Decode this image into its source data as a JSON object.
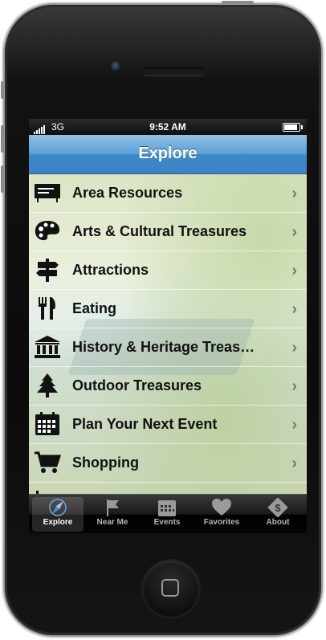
{
  "status_bar": {
    "network": "3G",
    "time": "9:52 AM"
  },
  "nav": {
    "title": "Explore"
  },
  "menu": [
    {
      "label": "Area Resources",
      "icon": "sign-board-icon"
    },
    {
      "label": "Arts & Cultural Treasures",
      "icon": "palette-icon"
    },
    {
      "label": "Attractions",
      "icon": "signpost-icon"
    },
    {
      "label": "Eating",
      "icon": "fork-knife-icon"
    },
    {
      "label": "History & Heritage Treas…",
      "icon": "museum-icon"
    },
    {
      "label": "Outdoor Treasures",
      "icon": "pine-tree-icon"
    },
    {
      "label": "Plan Your Next Event",
      "icon": "calendar-icon"
    },
    {
      "label": "Shopping",
      "icon": "cart-icon"
    }
  ],
  "tabs": [
    {
      "label": "Explore",
      "icon": "compass-icon",
      "active": true
    },
    {
      "label": "Near Me",
      "icon": "flag-icon",
      "active": false
    },
    {
      "label": "Events",
      "icon": "calendar-icon",
      "active": false
    },
    {
      "label": "Favorites",
      "icon": "heart-icon",
      "active": false
    },
    {
      "label": "About",
      "icon": "money-icon",
      "active": false
    }
  ],
  "colors": {
    "nav_blue": "#4a90d0",
    "tab_active": "#ffffff",
    "tab_inactive": "#b5b5b5"
  }
}
